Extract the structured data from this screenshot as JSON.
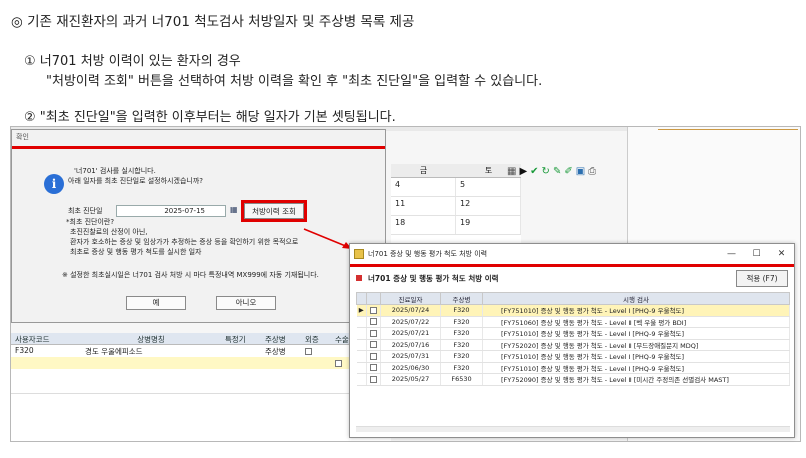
{
  "notes": {
    "title": "◎ 기존 재진환자의 과거 너701 척도검사 처방일자 및 주상병 목록 제공",
    "item1": "① 너701 처방 이력이 있는 환자의 경우",
    "item1_detail": "\"처방이력 조회\" 버튼을 선택하여 처방 이력을 확인 후 \"최초 진단일\"을 입력할 수 있습니다.",
    "item2": "② \"최초 진단일\"을 입력한 이후부터는 해당 일자가 기본 셋팅됩니다."
  },
  "calendar": {
    "headers": [
      "금",
      "토"
    ],
    "rows": [
      [
        "4",
        "5"
      ],
      [
        "11",
        "12"
      ],
      [
        "18",
        "19"
      ]
    ]
  },
  "toolbar_icons": [
    "calendar-icon",
    "play-icon",
    "check-icon",
    "refresh-icon",
    "pin-icon",
    "edit-icon",
    "save-icon",
    "print-icon"
  ],
  "confirm_dialog": {
    "title": "확인",
    "message_line1": "'너701' 검사를 실시합니다.",
    "message_line2": "아래 일자를 최초 진단일로 설정하시겠습니까?",
    "date_label": "최초 진단일",
    "date_value": "2025-07-15",
    "history_button": "처방이력 조회",
    "help_q": "*최초 진단이란?",
    "help_1": "초진진찰료의 산정이 아닌,",
    "help_2": "환자가 호소하는 증상 및 임상가가 추정하는 증상 등을 확인하기 위한 목적으로",
    "help_3": "최초로 증상 및 행동 평가 척도를 실시한 일자",
    "footnote": "※ 설정한 최초실시일은 너701 검사 처방 시 마다 특정내역 MX999에 자동 기재됩니다.",
    "yes": "예",
    "no": "아니오"
  },
  "background_grid": {
    "headers": [
      "사용자코드",
      "상병명칭",
      "특정기",
      "주상병",
      "외증",
      "수술"
    ],
    "row1": [
      "F320",
      "경도 우울에피소드",
      "",
      "주상병"
    ]
  },
  "history_window": {
    "title": "너701 증상 및 행동 평가 척도 처방 이력",
    "heading": "너701 증상 및 행동 평가 척도 처방 이력",
    "apply_button": "적용 (F7)",
    "controls": [
      "—",
      "☐",
      "✕"
    ],
    "columns": [
      "진료일자",
      "주상병",
      "시행 검사"
    ],
    "rows": [
      {
        "date": "2025/07/24",
        "code": "F320",
        "test": "[FY751010] 증상 및 행동 평가 척도 - Level Ⅰ [PHQ-9 우울척도]",
        "selected": true
      },
      {
        "date": "2025/07/22",
        "code": "F320",
        "test": "[FY751060] 증상 및 행동 평가 척도 - Level Ⅱ [벡 우울 평가 BDI]",
        "selected": false
      },
      {
        "date": "2025/07/21",
        "code": "F320",
        "test": "[FY751010] 증상 및 행동 평가 척도 - Level Ⅰ [PHQ-9 우울척도]",
        "selected": false
      },
      {
        "date": "2025/07/16",
        "code": "F320",
        "test": "[FY752020] 증상 및 행동 평가 척도 - Level Ⅱ [무드장애질문지 MDQ]",
        "selected": false
      },
      {
        "date": "2025/07/31",
        "code": "F320",
        "test": "[FY751010] 증상 및 행동 평가 척도 - Level Ⅰ [PHQ-9 우울척도]",
        "selected": false
      },
      {
        "date": "2025/06/30",
        "code": "F320",
        "test": "[FY751010] 증상 및 행동 평가 척도 - Level Ⅰ [PHQ-9 우울척도]",
        "selected": false
      },
      {
        "date": "2025/05/27",
        "code": "F6530",
        "test": "[FY752090] 증상 및 행동 평가 척도 - Level Ⅱ [미시간 주정의존 선별검사 MAST]",
        "selected": false
      }
    ]
  },
  "colors": {
    "accent_red": "#e00000",
    "selected_row": "#fff4b8",
    "info_blue": "#2a6fd6"
  }
}
